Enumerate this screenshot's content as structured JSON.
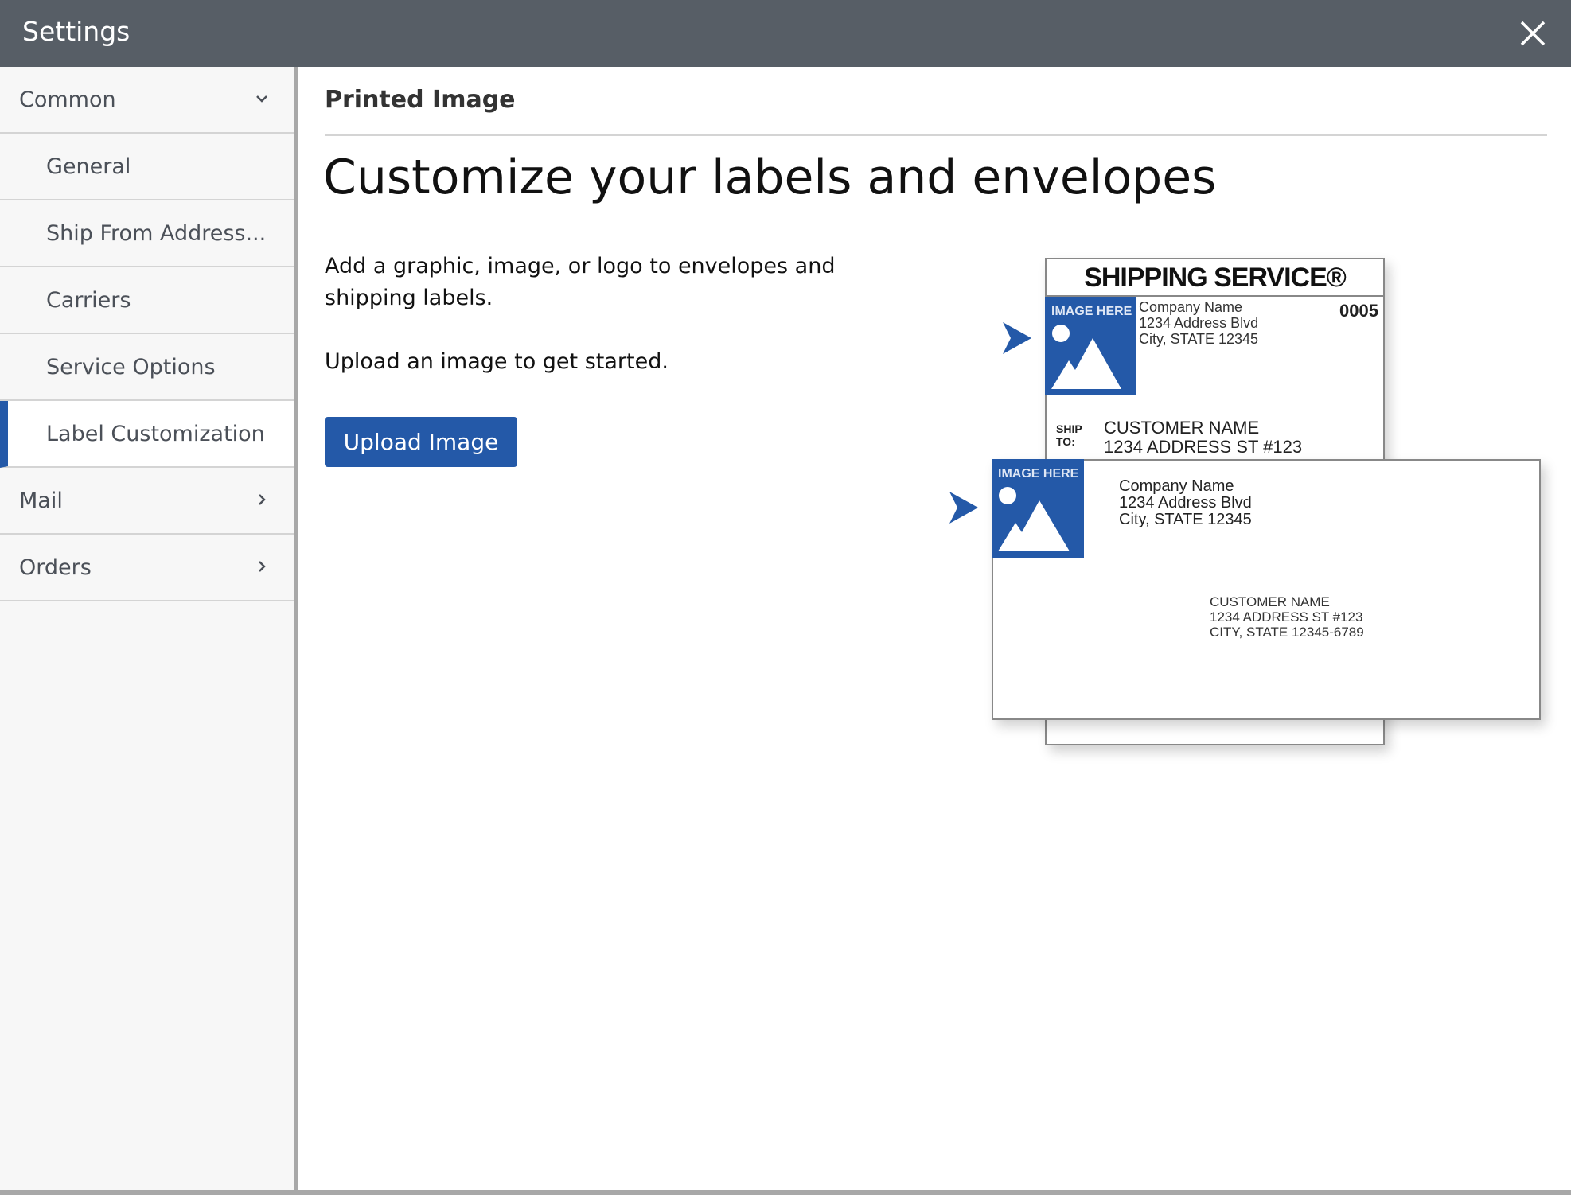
{
  "header": {
    "title": "Settings",
    "close_icon": "close-icon"
  },
  "sidebar": {
    "items": [
      {
        "label": "Common",
        "level": "top",
        "icon": "chevron-down-icon"
      },
      {
        "label": "General",
        "level": "sub"
      },
      {
        "label": "Ship From Address...",
        "level": "sub"
      },
      {
        "label": "Carriers",
        "level": "sub"
      },
      {
        "label": "Service Options",
        "level": "sub"
      },
      {
        "label": "Label Customization",
        "level": "sub",
        "active": true
      },
      {
        "label": "Mail",
        "level": "top",
        "icon": "chevron-right-icon"
      },
      {
        "label": "Orders",
        "level": "top",
        "icon": "chevron-right-icon"
      }
    ]
  },
  "main": {
    "section_title": "Printed Image",
    "headline": "Customize your labels and envelopes",
    "description": "Add a graphic, image, or logo to envelopes and shipping labels.",
    "instruction": "Upload an image to get started.",
    "upload_button": "Upload Image"
  },
  "illustration": {
    "label": {
      "service": "SHIPPING SERVICE®",
      "image_placeholder": "IMAGE HERE",
      "from": [
        "Company Name",
        "1234 Address Blvd",
        "City, STATE 12345"
      ],
      "number": "0005",
      "ship_to_label": [
        "SHIP",
        "TO:"
      ],
      "to": [
        "CUSTOMER NAME",
        "1234 ADDRESS ST #123"
      ]
    },
    "envelope": {
      "image_placeholder": "IMAGE HERE",
      "from": [
        "Company Name",
        "1234 Address Blvd",
        "City, STATE 12345"
      ],
      "to": [
        "CUSTOMER NAME",
        "1234 ADDRESS ST #123",
        "CITY, STATE 12345-6789"
      ]
    }
  },
  "colors": {
    "accent": "#2459a8",
    "header": "#575e66",
    "sidebar": "#f7f7f7"
  }
}
